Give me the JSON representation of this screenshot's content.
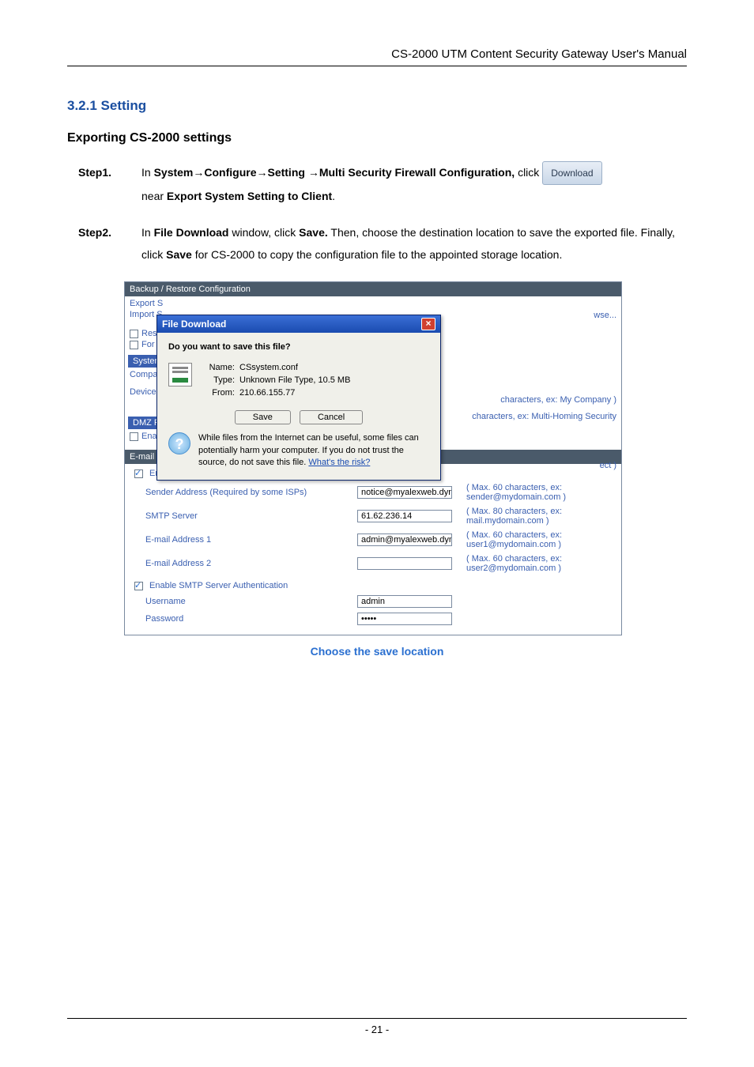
{
  "header": "CS-2000 UTM Content Security Gateway User's Manual",
  "section_number": "3.2.1 Setting",
  "subsection": "Exporting CS-2000 settings",
  "step1": {
    "label": "Step1.",
    "pre": "In ",
    "path": "System→Configure→Setting →Multi Security Firewall Configuration,",
    "mid": " click ",
    "btn": "Download",
    "post1": "near ",
    "post_bold": "Export System Setting to Client",
    "post2": "."
  },
  "step2": {
    "label": "Step2.",
    "t1": "In ",
    "b1": "File Download",
    "t2": " window, click ",
    "b2": "Save.",
    "t3": " Then, choose the destination location to save the exported file. Finally, click ",
    "b3": "Save",
    "t4": " for CS-2000 to copy the configuration file to the appointed storage location."
  },
  "shot": {
    "bar": "Backup / Restore Configuration",
    "export": "Export S",
    "import": "Import S",
    "browse": "wse...",
    "res": "Res",
    "for": "For",
    "system": "System",
    "compan": "Compan",
    "device": "Device N",
    "hint1": "characters, ex: My Company )",
    "hint2": "characters, ex: Multi-Homing Security",
    "dmz": "DMZ P",
    "ena": "Ena",
    "ect": "ect )",
    "email_bar": "E-mail Setting",
    "enable_email": "Enable E-mail Alert Notification",
    "sender_lbl": "Sender Address (Required by some ISPs)",
    "sender_val": "notice@myalexweb.dyndr",
    "sender_note": "( Max. 60 characters, ex: sender@mydomain.com )",
    "smtp_lbl": "SMTP Server",
    "smtp_val": "61.62.236.14",
    "smtp_note": "( Max. 80 characters, ex: mail.mydomain.com )",
    "e1_lbl": "E-mail Address 1",
    "e1_val": "admin@myalexweb.dyndr",
    "e1_note": "( Max. 60 characters, ex: user1@mydomain.com )",
    "e2_lbl": "E-mail Address 2",
    "e2_val": "",
    "e2_note": "( Max. 60 characters, ex: user2@mydomain.com )",
    "enable_smtp": "Enable SMTP Server Authentication",
    "user_lbl": "Username",
    "user_val": "admin",
    "pass_lbl": "Password",
    "pass_val": "•••••"
  },
  "dialog": {
    "title": "File Download",
    "question": "Do you want to save this file?",
    "name_k": "Name:",
    "name_v": "CSsystem.conf",
    "type_k": "Type:",
    "type_v": "Unknown File Type, 10.5 MB",
    "from_k": "From:",
    "from_v": "210.66.155.77",
    "save": "Save",
    "cancel": "Cancel",
    "warn": "While files from the Internet can be useful, some files can potentially harm your computer. If you do not trust the source, do not save this file. ",
    "risk": "What's the risk?"
  },
  "caption": "Choose the save location",
  "page_no": "- 21 -"
}
